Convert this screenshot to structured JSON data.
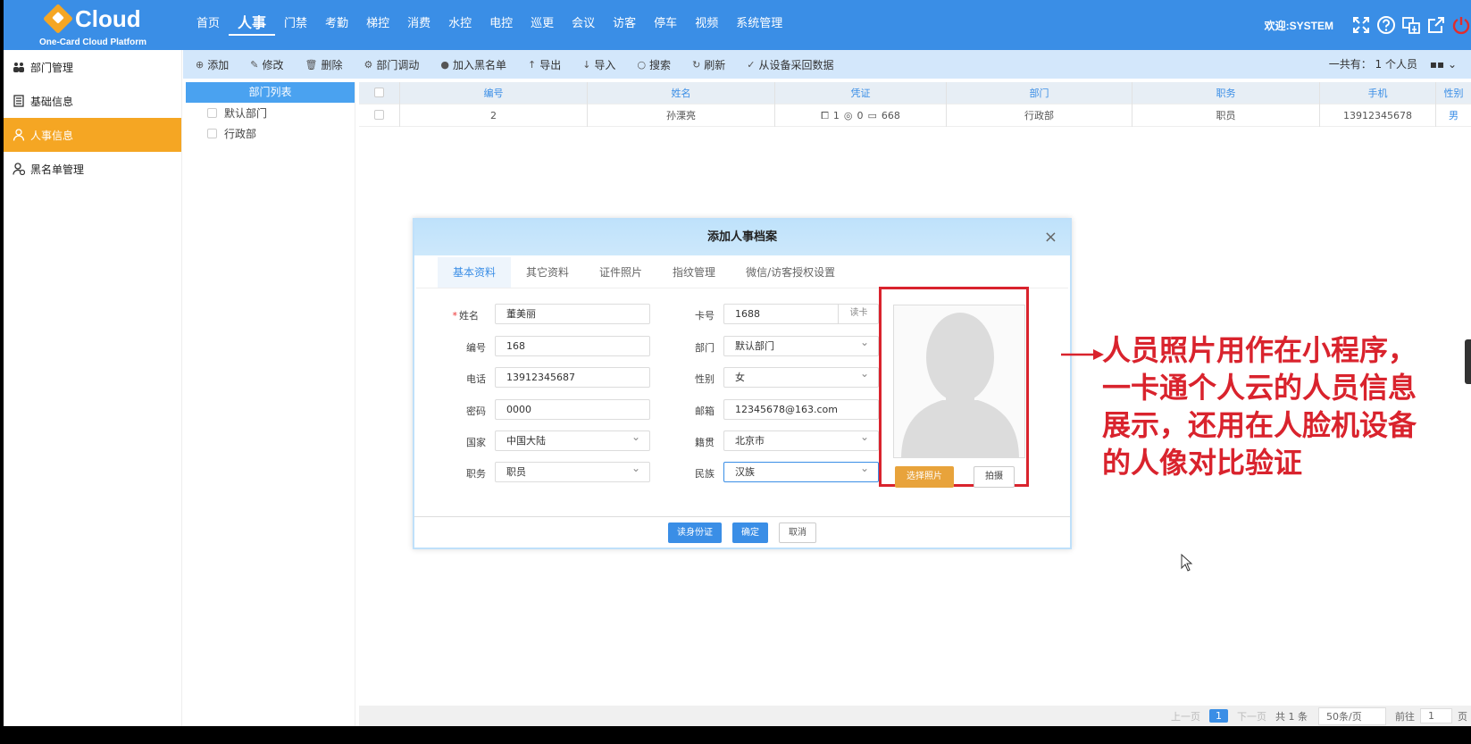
{
  "header": {
    "brand": "Cloud",
    "brand_sub": "One-Card Cloud Platform",
    "nav": [
      "首页",
      "人事",
      "门禁",
      "考勤",
      "梯控",
      "消费",
      "水控",
      "电控",
      "巡更",
      "会议",
      "访客",
      "停车",
      "视频",
      "系统管理"
    ],
    "active_nav": "人事",
    "welcome": "欢迎:SYSTEM",
    "icons": [
      "fullscreen-icon",
      "help-icon",
      "language-icon",
      "external-link-icon",
      "power-icon"
    ]
  },
  "sidebar": {
    "items": [
      {
        "label": "部门管理",
        "icon": "org-icon"
      },
      {
        "label": "基础信息",
        "icon": "document-icon"
      },
      {
        "label": "人事信息",
        "icon": "person-icon",
        "active": true
      },
      {
        "label": "黑名单管理",
        "icon": "blacklist-icon"
      }
    ]
  },
  "toolbar": {
    "buttons": [
      {
        "icon": "⊕",
        "label": "添加"
      },
      {
        "icon": "✎",
        "label": "修改"
      },
      {
        "icon": "🗑",
        "label": "删除"
      },
      {
        "icon": "⚙",
        "label": "部门调动"
      },
      {
        "icon": "●",
        "label": "加入黑名单"
      },
      {
        "icon": "↑",
        "label": "导出"
      },
      {
        "icon": "↓",
        "label": "导入"
      },
      {
        "icon": "○",
        "label": "搜索"
      },
      {
        "icon": "↻",
        "label": "刷新"
      },
      {
        "icon": "✓",
        "label": "从设备采回数据"
      }
    ],
    "total": "一共有： 1 个人员"
  },
  "dept": {
    "title": "部门列表",
    "items": [
      "默认部门",
      "行政部"
    ]
  },
  "table": {
    "columns": [
      "编号",
      "姓名",
      "凭证",
      "部门",
      "职务",
      "手机",
      "性别"
    ],
    "rows": [
      {
        "id": "2",
        "name": "孙溧亮",
        "cred_face": "1",
        "cred_fp": "0",
        "cred_card": "668",
        "dept": "行政部",
        "title": "职员",
        "phone": "13912345678",
        "gender": "男"
      }
    ]
  },
  "pager": {
    "prev": "上一页",
    "current": "1",
    "next": "下一页",
    "total": "共 1 条",
    "size": "50条/页",
    "goto": "前往",
    "page_input": "1",
    "page_unit": "页"
  },
  "modal": {
    "title": "添加人事档案",
    "tabs": [
      "基本资料",
      "其它资料",
      "证件照片",
      "指纹管理",
      "微信/访客授权设置"
    ],
    "fields": {
      "name_label": "姓名",
      "name": "董美丽",
      "no_label": "编号",
      "no": "168",
      "phone_label": "电话",
      "phone": "13912345687",
      "pwd_label": "密码",
      "pwd": "0000",
      "country_label": "国家",
      "country": "中国大陆",
      "job_label": "职务",
      "job": "职员",
      "card_label": "卡号",
      "card": "1688",
      "read_card": "读卡",
      "dept_label": "部门",
      "dept": "默认部门",
      "gender_label": "性别",
      "gender": "女",
      "email_label": "邮箱",
      "email": "12345678@163.com",
      "native_label": "籍贯",
      "native": "北京市",
      "nation_label": "民族",
      "nation": "汉族"
    },
    "choose_photo": "选择照片",
    "shoot": "拍摄",
    "read_id": "读身份证",
    "ok": "确定",
    "cancel": "取消"
  },
  "annotation": {
    "lines": [
      "人员照片用作在小程序，",
      "一卡通个人云的人员信息",
      "展示，还用在人脸机设备",
      "的人像对比验证"
    ],
    "color": "#d9232d"
  }
}
